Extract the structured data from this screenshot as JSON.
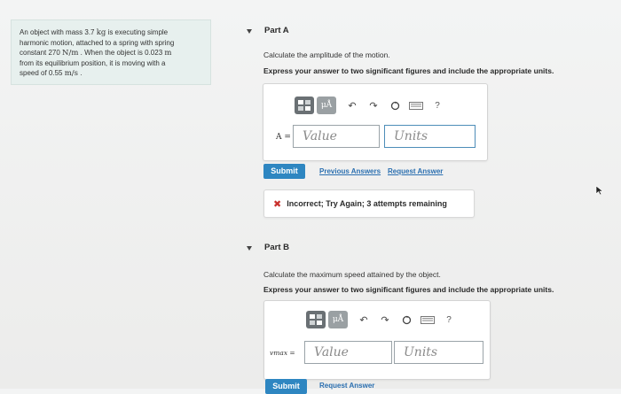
{
  "problem": {
    "segments": [
      "An object with mass 3.7 ",
      "kg",
      " is executing simple",
      "harmonic motion, attached to a spring with spring",
      "constant 270 ",
      "N/m",
      " . When the object is 0.023 ",
      "m",
      "from its equilibrium position, it is moving with a",
      "speed of 0.55 ",
      "m/s",
      " ."
    ]
  },
  "partA": {
    "title": "Part A",
    "prompt": "Calculate the amplitude of the motion.",
    "instructions": "Express your answer to two significant figures and include the appropriate units.",
    "toolbar": {
      "mu_label": "μÅ",
      "help": "?"
    },
    "var_label": "A =",
    "value_placeholder": "Value",
    "units_placeholder": "Units",
    "submit": "Submit",
    "previous_answers": "Previous Answers",
    "request_answer": "Request Answer",
    "feedback": "Incorrect; Try Again; 3 attempts remaining"
  },
  "partB": {
    "title": "Part B",
    "prompt": "Calculate the maximum speed attained by the object.",
    "instructions": "Express your answer to two significant figures and include the appropriate units.",
    "toolbar": {
      "mu_label": "μÅ",
      "help": "?"
    },
    "var_label": "vmax =",
    "value_placeholder": "Value",
    "units_placeholder": "Units",
    "submit": "Submit",
    "request_answer": "Request Answer"
  }
}
